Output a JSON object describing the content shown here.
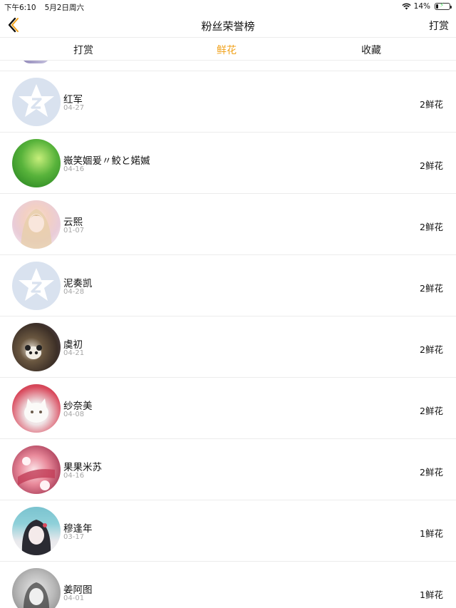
{
  "status_bar": {
    "time": "下午6:10",
    "date": "5月2日周六",
    "battery": "14%",
    "battery_level": 0.14
  },
  "nav": {
    "title": "粉丝荣誉榜",
    "right_label": "打赏"
  },
  "tabs": [
    {
      "label": "打赏",
      "active": false
    },
    {
      "label": "鲜花",
      "active": true
    },
    {
      "label": "收藏",
      "active": false
    }
  ],
  "accent_color": "#f0a21c",
  "fans": [
    {
      "name": "红军",
      "date": "04-27",
      "count": "2鲜花",
      "avatar": "qq-default-avatar"
    },
    {
      "name": "嶶笑婟爰〃鲛と婼媙",
      "date": "04-16",
      "count": "2鲜花",
      "avatar": "green-avatar"
    },
    {
      "name": "云熙",
      "date": "01-07",
      "count": "2鲜花",
      "avatar": "anime-girl-avatar"
    },
    {
      "name": "泥奏凯",
      "date": "04-28",
      "count": "2鲜花",
      "avatar": "qq-default-avatar"
    },
    {
      "name": "虞初",
      "date": "04-21",
      "count": "2鲜花",
      "avatar": "panda-avatar"
    },
    {
      "name": "纱奈美",
      "date": "04-08",
      "count": "2鲜花",
      "avatar": "cat-avatar"
    },
    {
      "name": "果果米苏",
      "date": "04-16",
      "count": "2鲜花",
      "avatar": "pink-avatar"
    },
    {
      "name": "穆逢年",
      "date": "03-17",
      "count": "1鲜花",
      "avatar": "anime-boy-avatar"
    },
    {
      "name": "姜阿图",
      "date": "04-01",
      "count": "1鲜花",
      "avatar": "gray-avatar"
    }
  ]
}
